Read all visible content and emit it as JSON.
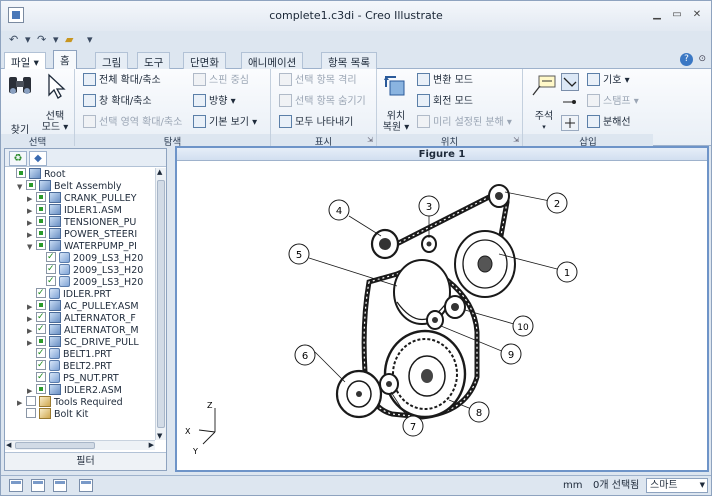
{
  "window": {
    "title": "complete1.c3di - Creo Illustrate"
  },
  "qat": {
    "undo": "↶",
    "redo": "↷",
    "open": "📂",
    "more": "▾"
  },
  "tabs": [
    {
      "label": "파일 ▾"
    },
    {
      "label": "홈"
    },
    {
      "label": "그림"
    },
    {
      "label": "도구"
    },
    {
      "label": "단면화"
    },
    {
      "label": "애니메이션"
    },
    {
      "label": "항목 목록"
    }
  ],
  "ribbon": {
    "groups": {
      "selection": "선택",
      "navigation": "탐색",
      "display": "표시",
      "position": "위치",
      "insert": "삽입"
    },
    "find": "찾기",
    "select_mode": "선택\n모드 ▾",
    "zoom_all": "전체 확대/축소",
    "zoom_window": "창 확대/축소",
    "zoom_selected_area": "선택 영역 확대/축소",
    "spin_center": "스핀 중심",
    "orientation": "방향 ▾",
    "default_view": "기본 보기 ▾",
    "isolate_selected": "선택 항목 격리",
    "hide_selected": "선택 항목 숨기기",
    "show_all": "모두 나타내기",
    "reposition": "위치\n복원 ▾",
    "translate_mode": "변환 모드",
    "rotate_mode": "회전 모드",
    "preset_explode": "미리 설정된 분해 ▾",
    "callout": "주석",
    "symbol": "기호 ▾",
    "stamp": "스탬프 ▾",
    "explode_line": "분해선"
  },
  "tree": {
    "items": [
      {
        "label": "Root",
        "type": "asm",
        "check": "partial",
        "twisty": ""
      },
      {
        "label": "Belt Assembly",
        "type": "asm",
        "check": "partial",
        "twisty": "▼"
      },
      {
        "label": "CRANK_PULLEY",
        "type": "asm",
        "check": "partial",
        "twisty": "▶"
      },
      {
        "label": "IDLER1.ASM",
        "type": "asm",
        "check": "partial",
        "twisty": "▶"
      },
      {
        "label": "TENSIONER_PU",
        "type": "asm",
        "check": "partial",
        "twisty": "▶"
      },
      {
        "label": "POWER_STEERI",
        "type": "asm",
        "check": "partial",
        "twisty": "▶"
      },
      {
        "label": "WATERPUMP_PI",
        "type": "asm",
        "check": "partial",
        "twisty": "▼"
      },
      {
        "label": "2009_LS3_H20",
        "type": "part",
        "check": "checked",
        "twisty": ""
      },
      {
        "label": "2009_LS3_H20",
        "type": "part",
        "check": "checked",
        "twisty": ""
      },
      {
        "label": "2009_LS3_H20",
        "type": "part",
        "check": "checked",
        "twisty": ""
      },
      {
        "label": "IDLER.PRT",
        "type": "part",
        "check": "checked",
        "twisty": ""
      },
      {
        "label": "AC_PULLEY.ASM",
        "type": "asm",
        "check": "partial",
        "twisty": "▶"
      },
      {
        "label": "ALTERNATOR_F",
        "type": "asm",
        "check": "checked",
        "twisty": "▶"
      },
      {
        "label": "ALTERNATOR_M",
        "type": "asm",
        "check": "checked",
        "twisty": "▶"
      },
      {
        "label": "SC_DRIVE_PULL",
        "type": "asm",
        "check": "partial",
        "twisty": "▶"
      },
      {
        "label": "BELT1.PRT",
        "type": "part",
        "check": "checked",
        "twisty": ""
      },
      {
        "label": "BELT2.PRT",
        "type": "part",
        "check": "checked",
        "twisty": ""
      },
      {
        "label": "PS_NUT.PRT",
        "type": "part",
        "check": "checked",
        "twisty": ""
      },
      {
        "label": "IDLER2.ASM",
        "type": "asm",
        "check": "partial",
        "twisty": "▶"
      },
      {
        "label": "Tools Required",
        "type": "tool",
        "check": "none",
        "twisty": "▶"
      },
      {
        "label": "Bolt Kit",
        "type": "tool",
        "check": "none",
        "twisty": ""
      }
    ]
  },
  "panel": {
    "filter": "필터"
  },
  "figure": {
    "title": "Figure 1",
    "callouts": [
      "1",
      "2",
      "3",
      "4",
      "5",
      "6",
      "7",
      "8",
      "9",
      "10"
    ],
    "axes": {
      "x": "X",
      "y": "Y",
      "z": "Z"
    }
  },
  "status": {
    "units": "mm",
    "selection": "0개 선택됨",
    "mode": "스마트"
  }
}
